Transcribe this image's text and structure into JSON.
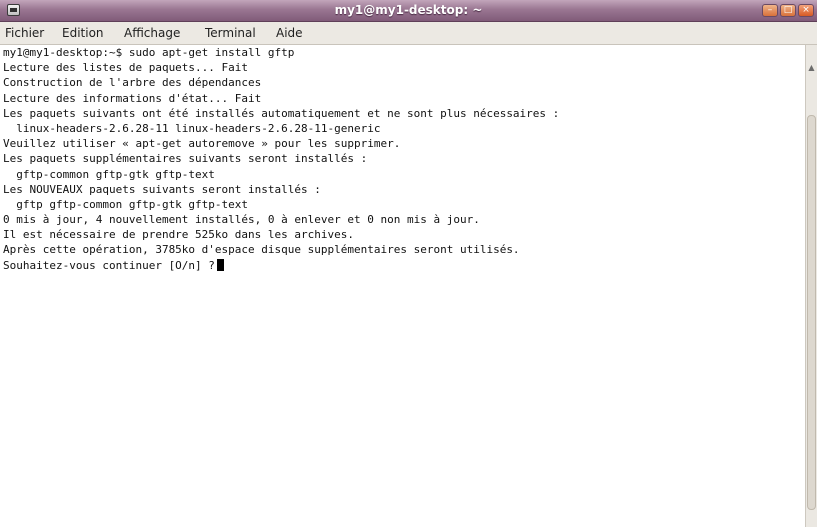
{
  "window": {
    "title": "my1@my1-desktop: ~"
  },
  "menubar": {
    "items": [
      {
        "label": "Fichier"
      },
      {
        "label": "Edition"
      },
      {
        "label": "Affichage"
      },
      {
        "label": "Terminal"
      },
      {
        "label": "Aide"
      }
    ]
  },
  "terminal": {
    "lines": [
      "my1@my1-desktop:~$ sudo apt-get install gftp",
      "Lecture des listes de paquets... Fait",
      "Construction de l'arbre des dépendances",
      "Lecture des informations d'état... Fait",
      "Les paquets suivants ont été installés automatiquement et ne sont plus nécessaires :",
      "  linux-headers-2.6.28-11 linux-headers-2.6.28-11-generic",
      "Veuillez utiliser « apt-get autoremove » pour les supprimer.",
      "Les paquets supplémentaires suivants seront installés :",
      "  gftp-common gftp-gtk gftp-text",
      "Les NOUVEAUX paquets suivants seront installés :",
      "  gftp gftp-common gftp-gtk gftp-text",
      "0 mis à jour, 4 nouvellement installés, 0 à enlever et 0 non mis à jour.",
      "Il est nécessaire de prendre 525ko dans les archives.",
      "Après cette opération, 3785ko d'espace disque supplémentaires seront utilisés.",
      "Souhaitez-vous continuer [O/n] ?"
    ]
  },
  "icons": {
    "window_icon": "terminal-icon",
    "minimize": "minimize-icon",
    "maximize": "maximize-icon",
    "close": "close-icon"
  },
  "colors": {
    "titlebar": "#9a7692",
    "terminal_background": "#ffffff",
    "terminal_text": "#111111"
  }
}
